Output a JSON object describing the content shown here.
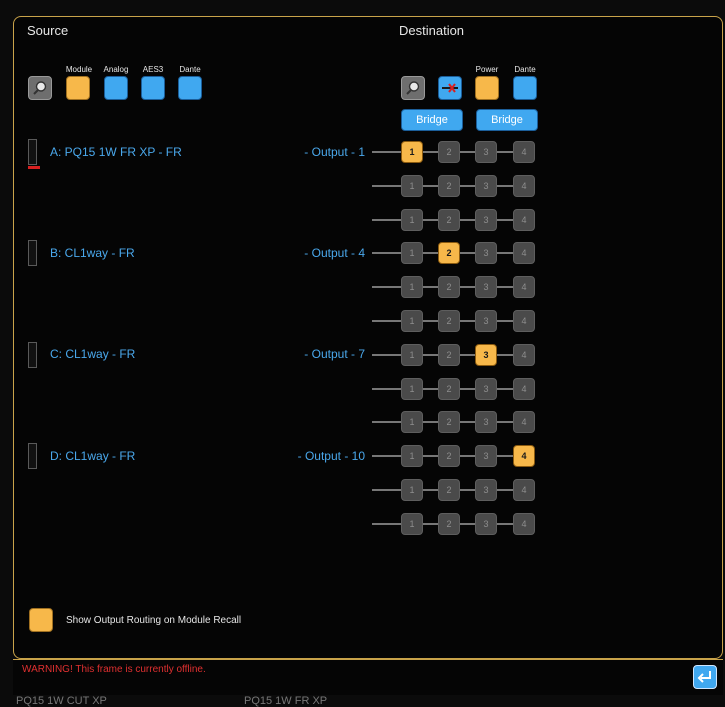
{
  "source": {
    "heading": "Source",
    "filters": [
      "Module",
      "Analog",
      "AES3",
      "Dante"
    ],
    "channels": [
      {
        "label": "A: PQ15 1W FR XP - FR",
        "output": "- Output - 1"
      },
      {
        "label": "B: CL1way - FR",
        "output": "- Output - 4"
      },
      {
        "label": "C: CL1way - FR",
        "output": "- Output - 7"
      },
      {
        "label": "D: CL1way - FR",
        "output": "- Output - 10"
      }
    ]
  },
  "destination": {
    "heading": "Destination",
    "filters": [
      "Power",
      "Dante"
    ],
    "bridge_labels": [
      "Bridge",
      "Bridge"
    ],
    "matrix_cols": [
      "1",
      "2",
      "3",
      "4"
    ],
    "rows": [
      {
        "active": 1
      },
      {
        "active": 0
      },
      {
        "active": 0
      },
      {
        "active": 2
      },
      {
        "active": 0
      },
      {
        "active": 0
      },
      {
        "active": 3
      },
      {
        "active": 0
      },
      {
        "active": 0
      },
      {
        "active": 4
      },
      {
        "active": 0
      },
      {
        "active": 0
      }
    ]
  },
  "options": {
    "show_routing_label": "Show Output Routing on Module Recall"
  },
  "status": {
    "warning": "WARNING! This frame is currently offline."
  },
  "background_strip": [
    "PQ15 1W CUT XP",
    "PQ15 1W FR XP"
  ],
  "colors": {
    "accent_orange": "#f7b84a",
    "accent_blue": "#40a8f0",
    "frame_border": "#c9a34a",
    "warning_red": "#e03030"
  }
}
